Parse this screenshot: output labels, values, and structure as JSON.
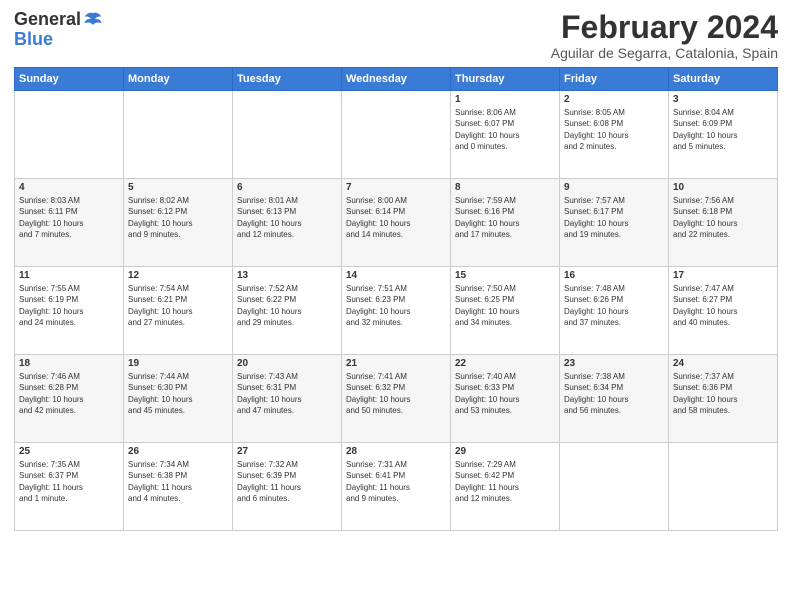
{
  "logo": {
    "general": "General",
    "blue": "Blue"
  },
  "title": "February 2024",
  "subtitle": "Aguilar de Segarra, Catalonia, Spain",
  "headers": [
    "Sunday",
    "Monday",
    "Tuesday",
    "Wednesday",
    "Thursday",
    "Friday",
    "Saturday"
  ],
  "weeks": [
    [
      {
        "num": "",
        "info": ""
      },
      {
        "num": "",
        "info": ""
      },
      {
        "num": "",
        "info": ""
      },
      {
        "num": "",
        "info": ""
      },
      {
        "num": "1",
        "info": "Sunrise: 8:06 AM\nSunset: 6:07 PM\nDaylight: 10 hours\nand 0 minutes."
      },
      {
        "num": "2",
        "info": "Sunrise: 8:05 AM\nSunset: 6:08 PM\nDaylight: 10 hours\nand 2 minutes."
      },
      {
        "num": "3",
        "info": "Sunrise: 8:04 AM\nSunset: 6:09 PM\nDaylight: 10 hours\nand 5 minutes."
      }
    ],
    [
      {
        "num": "4",
        "info": "Sunrise: 8:03 AM\nSunset: 6:11 PM\nDaylight: 10 hours\nand 7 minutes."
      },
      {
        "num": "5",
        "info": "Sunrise: 8:02 AM\nSunset: 6:12 PM\nDaylight: 10 hours\nand 9 minutes."
      },
      {
        "num": "6",
        "info": "Sunrise: 8:01 AM\nSunset: 6:13 PM\nDaylight: 10 hours\nand 12 minutes."
      },
      {
        "num": "7",
        "info": "Sunrise: 8:00 AM\nSunset: 6:14 PM\nDaylight: 10 hours\nand 14 minutes."
      },
      {
        "num": "8",
        "info": "Sunrise: 7:59 AM\nSunset: 6:16 PM\nDaylight: 10 hours\nand 17 minutes."
      },
      {
        "num": "9",
        "info": "Sunrise: 7:57 AM\nSunset: 6:17 PM\nDaylight: 10 hours\nand 19 minutes."
      },
      {
        "num": "10",
        "info": "Sunrise: 7:56 AM\nSunset: 6:18 PM\nDaylight: 10 hours\nand 22 minutes."
      }
    ],
    [
      {
        "num": "11",
        "info": "Sunrise: 7:55 AM\nSunset: 6:19 PM\nDaylight: 10 hours\nand 24 minutes."
      },
      {
        "num": "12",
        "info": "Sunrise: 7:54 AM\nSunset: 6:21 PM\nDaylight: 10 hours\nand 27 minutes."
      },
      {
        "num": "13",
        "info": "Sunrise: 7:52 AM\nSunset: 6:22 PM\nDaylight: 10 hours\nand 29 minutes."
      },
      {
        "num": "14",
        "info": "Sunrise: 7:51 AM\nSunset: 6:23 PM\nDaylight: 10 hours\nand 32 minutes."
      },
      {
        "num": "15",
        "info": "Sunrise: 7:50 AM\nSunset: 6:25 PM\nDaylight: 10 hours\nand 34 minutes."
      },
      {
        "num": "16",
        "info": "Sunrise: 7:48 AM\nSunset: 6:26 PM\nDaylight: 10 hours\nand 37 minutes."
      },
      {
        "num": "17",
        "info": "Sunrise: 7:47 AM\nSunset: 6:27 PM\nDaylight: 10 hours\nand 40 minutes."
      }
    ],
    [
      {
        "num": "18",
        "info": "Sunrise: 7:46 AM\nSunset: 6:28 PM\nDaylight: 10 hours\nand 42 minutes."
      },
      {
        "num": "19",
        "info": "Sunrise: 7:44 AM\nSunset: 6:30 PM\nDaylight: 10 hours\nand 45 minutes."
      },
      {
        "num": "20",
        "info": "Sunrise: 7:43 AM\nSunset: 6:31 PM\nDaylight: 10 hours\nand 47 minutes."
      },
      {
        "num": "21",
        "info": "Sunrise: 7:41 AM\nSunset: 6:32 PM\nDaylight: 10 hours\nand 50 minutes."
      },
      {
        "num": "22",
        "info": "Sunrise: 7:40 AM\nSunset: 6:33 PM\nDaylight: 10 hours\nand 53 minutes."
      },
      {
        "num": "23",
        "info": "Sunrise: 7:38 AM\nSunset: 6:34 PM\nDaylight: 10 hours\nand 56 minutes."
      },
      {
        "num": "24",
        "info": "Sunrise: 7:37 AM\nSunset: 6:36 PM\nDaylight: 10 hours\nand 58 minutes."
      }
    ],
    [
      {
        "num": "25",
        "info": "Sunrise: 7:35 AM\nSunset: 6:37 PM\nDaylight: 11 hours\nand 1 minute."
      },
      {
        "num": "26",
        "info": "Sunrise: 7:34 AM\nSunset: 6:38 PM\nDaylight: 11 hours\nand 4 minutes."
      },
      {
        "num": "27",
        "info": "Sunrise: 7:32 AM\nSunset: 6:39 PM\nDaylight: 11 hours\nand 6 minutes."
      },
      {
        "num": "28",
        "info": "Sunrise: 7:31 AM\nSunset: 6:41 PM\nDaylight: 11 hours\nand 9 minutes."
      },
      {
        "num": "29",
        "info": "Sunrise: 7:29 AM\nSunset: 6:42 PM\nDaylight: 11 hours\nand 12 minutes."
      },
      {
        "num": "",
        "info": ""
      },
      {
        "num": "",
        "info": ""
      }
    ]
  ]
}
